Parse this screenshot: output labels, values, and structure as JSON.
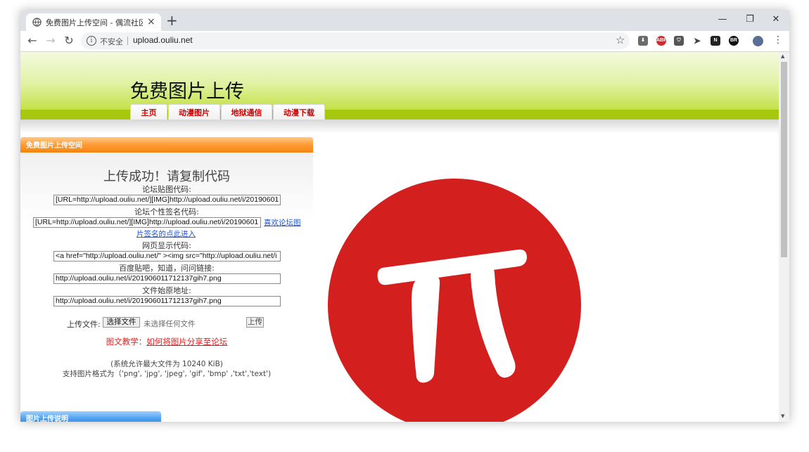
{
  "browser": {
    "tab_title": "免费图片上传空间 - 偶流社区免费",
    "tab_close": "×",
    "new_tab": "+",
    "window_controls": {
      "minimize": "—",
      "maximize": "❐",
      "close": "✕"
    },
    "nav": {
      "back": "←",
      "forward": "→",
      "reload": "↻"
    },
    "security_label": "不安全",
    "url": "upload.ouliu.net",
    "bookmark_icon": "☆",
    "extensions": [
      {
        "name": "download-icon",
        "text": "⬇",
        "color": "#6b6b6b"
      },
      {
        "name": "adblock-plus-icon",
        "text": "ABP",
        "color": "#d8262c"
      },
      {
        "name": "shield-extension-icon",
        "text": "⛉",
        "color": "#555555"
      },
      {
        "name": "send-extension-icon",
        "text": "➤",
        "color": "#444444"
      },
      {
        "name": "notion-extension-icon",
        "text": "N",
        "color": "#222222"
      },
      {
        "name": "br-extension-icon",
        "text": "BR",
        "color": "#111111"
      },
      {
        "name": "profile-avatar-icon",
        "text": "",
        "color": "#5a6f96"
      }
    ],
    "menu_icon": "⋮"
  },
  "site": {
    "title": "免费图片上传",
    "nav_tabs": [
      "主页",
      "动漫图片",
      "地狱通信",
      "动漫下载"
    ]
  },
  "panel": {
    "heading": "免费图片上传空间",
    "success_title": "上传成功！请复制代码",
    "fields": [
      {
        "label": "论坛贴图代码:",
        "value": "[URL=http://upload.ouliu.net/][IMG]http://upload.ouliu.net/i/20190601"
      },
      {
        "label": "论坛个性签名代码:",
        "value": "[URL=http://upload.ouliu.net/][IMG]http://upload.ouliu.net/i/20190601"
      },
      {
        "label": "网页显示代码:",
        "value": "<a href=\"http://upload.ouliu.net/\" ><img src=\"http://upload.ouliu.net/i"
      },
      {
        "label": "百度贴吧，知道，问问链接:",
        "value": "http://upload.ouliu.net/i/201906011712137gih7.png"
      },
      {
        "label": "文件始原地址:",
        "value": "http://upload.ouliu.net/i/201906011712137gih7.png"
      }
    ],
    "signature_link_line1": "喜欢论坛图",
    "signature_link_line2": "片签名的点此进入",
    "upload_label": "上传文件:",
    "choose_file_label": "选择文件",
    "no_file_text": "未选择任何文件",
    "upload_button_label": "上传",
    "tutorial_prefix": "图文教学：",
    "tutorial_link": "如何将图片分享至论坛",
    "size_limit": "(系统允许最大文件为 10240 KiB)",
    "formats": "支持图片格式为（'png', 'jpg', 'jpeg', 'gif', 'bmp' ,'txt','text')"
  },
  "panel2": {
    "heading": "图片上传说明"
  },
  "image": {
    "circle_color": "#d41f1f",
    "symbol": "π"
  }
}
